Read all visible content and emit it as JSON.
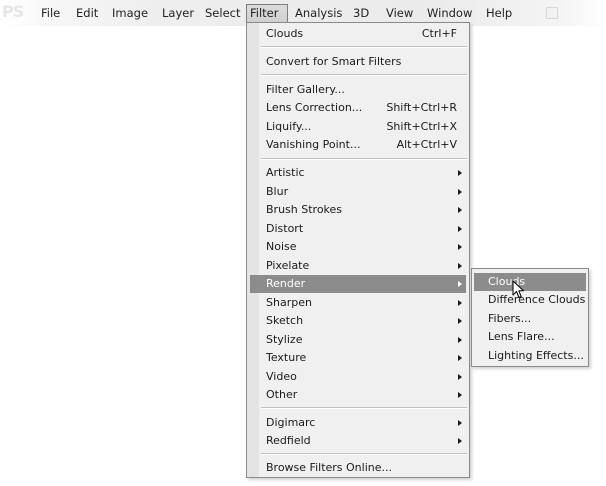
{
  "app": {
    "logo_text": "PS"
  },
  "menubar": {
    "items": [
      {
        "label": "File"
      },
      {
        "label": "Edit"
      },
      {
        "label": "Image"
      },
      {
        "label": "Layer"
      },
      {
        "label": "Select"
      },
      {
        "label": "Filter",
        "active": true
      },
      {
        "label": "Analysis"
      },
      {
        "label": "3D"
      },
      {
        "label": "View"
      },
      {
        "label": "Window"
      },
      {
        "label": "Help"
      }
    ]
  },
  "filter_menu": {
    "last_filter": {
      "label": "Clouds",
      "shortcut": "Ctrl+F"
    },
    "convert_smart": {
      "label": "Convert for Smart Filters"
    },
    "tools": [
      {
        "label": "Filter Gallery...",
        "shortcut": ""
      },
      {
        "label": "Lens Correction...",
        "shortcut": "Shift+Ctrl+R"
      },
      {
        "label": "Liquify...",
        "shortcut": "Shift+Ctrl+X"
      },
      {
        "label": "Vanishing Point...",
        "shortcut": "Alt+Ctrl+V"
      }
    ],
    "categories": [
      {
        "label": "Artistic"
      },
      {
        "label": "Blur"
      },
      {
        "label": "Brush Strokes"
      },
      {
        "label": "Distort"
      },
      {
        "label": "Noise"
      },
      {
        "label": "Pixelate"
      },
      {
        "label": "Render",
        "highlighted": true
      },
      {
        "label": "Sharpen"
      },
      {
        "label": "Sketch"
      },
      {
        "label": "Stylize"
      },
      {
        "label": "Texture"
      },
      {
        "label": "Video"
      },
      {
        "label": "Other"
      }
    ],
    "plugins": [
      {
        "label": "Digimarc"
      },
      {
        "label": "Redfield"
      }
    ],
    "browse_online": {
      "label": "Browse Filters Online..."
    }
  },
  "render_submenu": {
    "items": [
      {
        "label": "Clouds",
        "highlighted": true
      },
      {
        "label": "Difference Clouds"
      },
      {
        "label": "Fibers..."
      },
      {
        "label": "Lens Flare..."
      },
      {
        "label": "Lighting Effects..."
      }
    ]
  },
  "colors": {
    "highlight": "#8c8c8c",
    "menu_background": "#f0f0f0",
    "menubar_background": "#ebebeb"
  },
  "icons": {
    "submenu_indicator": "chevron-right-icon",
    "pointer": "mouse-pointer-icon"
  }
}
